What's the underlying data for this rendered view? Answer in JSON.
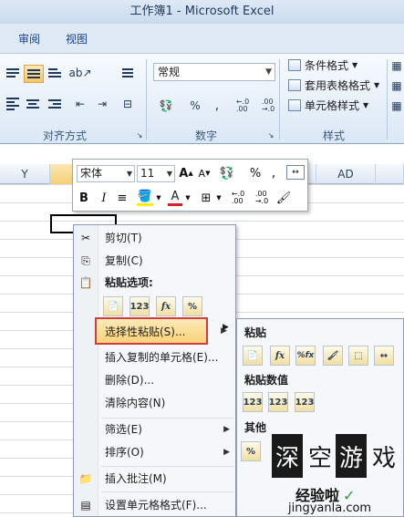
{
  "window": {
    "title": "工作簿1 - Microsoft Excel"
  },
  "ribbon": {
    "tabs": [
      {
        "label": "审阅"
      },
      {
        "label": "视图"
      }
    ],
    "number_format": "常规",
    "groups": {
      "alignment": "对齐方式",
      "number": "数字",
      "styles": "样式"
    },
    "number_buttons": {
      "percent": "%",
      "comma": ",",
      "inc_decimal": ".00→.0",
      "dec_decimal": ".0→.00"
    },
    "style_items": [
      "条件格式",
      "套用表格格式",
      "单元格样式"
    ]
  },
  "columns": {
    "left": "Y",
    "right": "AD"
  },
  "mini_toolbar": {
    "font": "宋体",
    "size": "11",
    "grow_font": "A",
    "shrink_font": "A",
    "percent": "%",
    "comma": ",",
    "bold": "B",
    "italic": "I",
    "font_color": "A"
  },
  "context_menu": {
    "items": [
      {
        "label": "剪切(T)",
        "icon": "scissors-icon"
      },
      {
        "label": "复制(C)",
        "icon": "copy-icon"
      },
      {
        "label": "粘贴选项:",
        "icon": "paste-icon"
      },
      {
        "label": "选择性粘贴(S)...",
        "icon": ""
      },
      {
        "label": "插入复制的单元格(E)...",
        "icon": ""
      },
      {
        "label": "删除(D)...",
        "icon": ""
      },
      {
        "label": "清除内容(N)",
        "icon": ""
      },
      {
        "label": "筛选(E)",
        "icon": ""
      },
      {
        "label": "排序(O)",
        "icon": ""
      },
      {
        "label": "插入批注(M)",
        "icon": "comment-icon"
      },
      {
        "label": "设置单元格格式(F)...",
        "icon": "format-cells-icon"
      }
    ],
    "paste_options": [
      "",
      "123",
      "fx",
      "%"
    ]
  },
  "submenu": {
    "sections": [
      {
        "header": "粘贴",
        "buttons": [
          "",
          "fx",
          "%fx",
          "",
          "",
          ""
        ]
      },
      {
        "header": "粘贴数值",
        "buttons": [
          "123",
          "123",
          "123"
        ]
      },
      {
        "header": "其他",
        "buttons": [
          "%"
        ]
      }
    ]
  },
  "watermark": {
    "chars": [
      "深",
      "空",
      "游",
      "戏"
    ],
    "site_cn": "经验啦",
    "site_url": "jingyanla.com"
  },
  "colors": {
    "ribbon_bg": "#dbe7f5",
    "highlight": "#f9d27a",
    "highlight_border": "#cf3d3d",
    "check": "#2a9d3b"
  }
}
